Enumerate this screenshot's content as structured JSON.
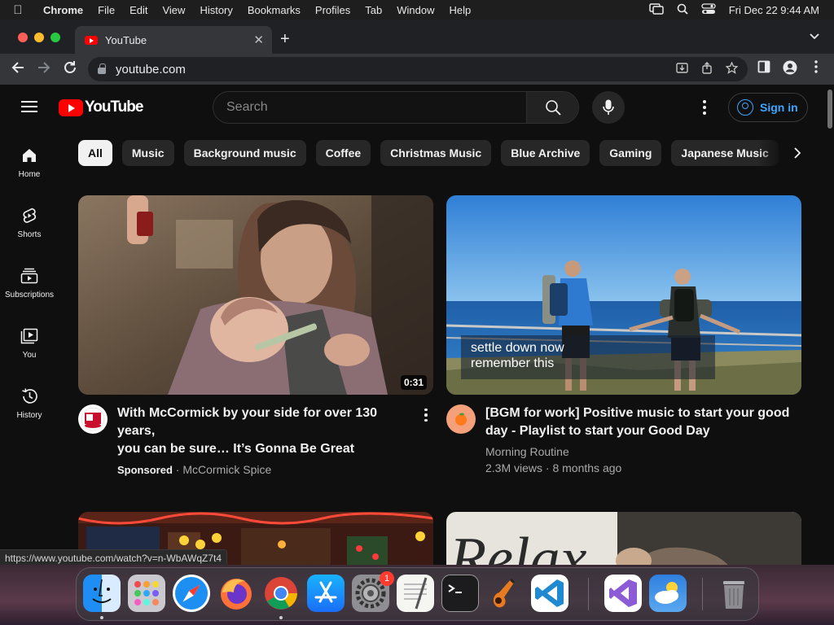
{
  "menubar": {
    "app": "Chrome",
    "items": [
      "File",
      "Edit",
      "View",
      "History",
      "Bookmarks",
      "Profiles",
      "Tab",
      "Window",
      "Help"
    ],
    "clock": "Fri Dec 22  9:44 AM"
  },
  "browser": {
    "tab_title": "YouTube",
    "url": "youtube.com",
    "status_url": "https://www.youtube.com/watch?v=n-WbAWqZ7t4"
  },
  "youtube": {
    "logo_text": "YouTube",
    "search_placeholder": "Search",
    "signin_label": "Sign in",
    "sidebar": [
      {
        "label": "Home",
        "icon": "home-icon"
      },
      {
        "label": "Shorts",
        "icon": "shorts-icon"
      },
      {
        "label": "Subscriptions",
        "icon": "subscriptions-icon"
      },
      {
        "label": "You",
        "icon": "you-icon"
      },
      {
        "label": "History",
        "icon": "history-icon"
      }
    ],
    "chips": [
      "All",
      "Music",
      "Background music",
      "Coffee",
      "Christmas Music",
      "Blue Archive",
      "Gaming",
      "Japanese Music"
    ],
    "videos": [
      {
        "title_line1": "With McCormick by your side for over 130 years,",
        "title_line2": "you can be sure… It’s Gonna Be Great",
        "duration": "0:31",
        "sponsored": "Sponsored",
        "channel": "McCormick Spice",
        "views": ""
      },
      {
        "title_line1": "[BGM for work] Positive music to start your good",
        "title_line2": "day - Playlist to start your Good Day",
        "overlay_line1": "settle down now",
        "overlay_line2": "remember this",
        "channel": "Morning Routine",
        "views": "2.3M views · 8 months ago"
      }
    ],
    "bottom_thumb_text": "Relax"
  },
  "dock": {
    "settings_badge": "1",
    "apps": [
      "finder-icon",
      "launchpad-icon",
      "safari-icon",
      "firefox-icon",
      "chrome-icon",
      "app-store-icon",
      "system-settings-icon",
      "textedit-icon",
      "terminal-icon",
      "garageband-icon",
      "vscode-icon",
      "visual-studio-icon",
      "weather-icon",
      "trash-icon"
    ]
  },
  "colors": {
    "accent": "#3ea6ff",
    "youtube_red": "#ff0000",
    "background": "#0f0f0f"
  }
}
